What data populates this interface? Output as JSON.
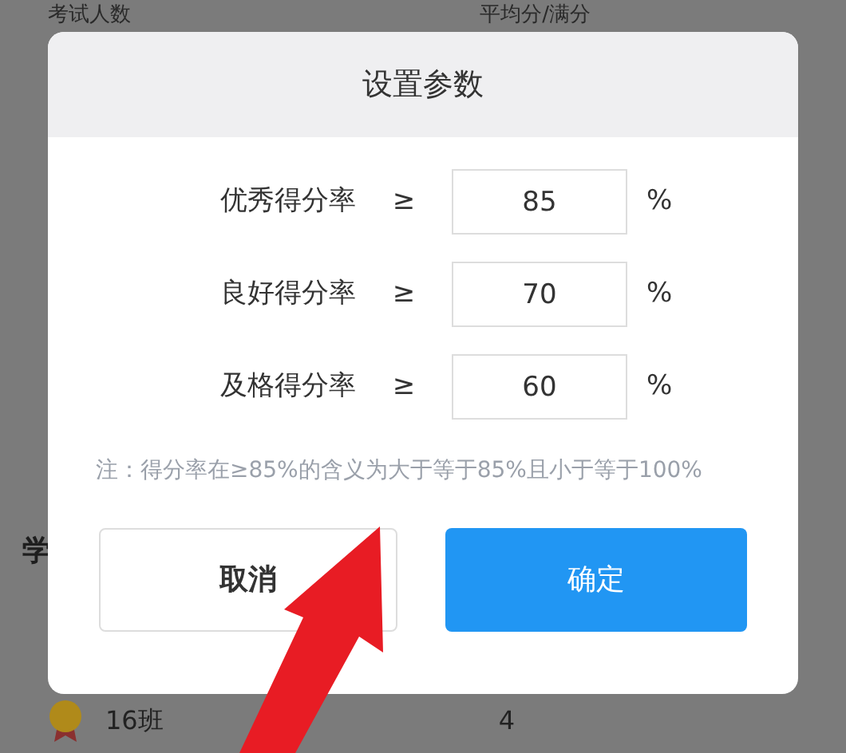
{
  "background": {
    "header_left": "考试人数",
    "header_right": "平均分/满分",
    "section_title_fragment": "学",
    "rows": [
      {
        "class_name": "16班",
        "count": "4"
      }
    ]
  },
  "dialog": {
    "title": "设置参数",
    "params": [
      {
        "label": "优秀得分率",
        "operator": "≥",
        "value": "85",
        "unit": "%"
      },
      {
        "label": "良好得分率",
        "operator": "≥",
        "value": "70",
        "unit": "%"
      },
      {
        "label": "及格得分率",
        "operator": "≥",
        "value": "60",
        "unit": "%"
      }
    ],
    "note": "注：得分率在≥85%的含义为大于等于85%且小于等于100%",
    "buttons": [
      {
        "label": "取消",
        "kind": "secondary"
      },
      {
        "label": "确定",
        "kind": "primary"
      }
    ]
  }
}
